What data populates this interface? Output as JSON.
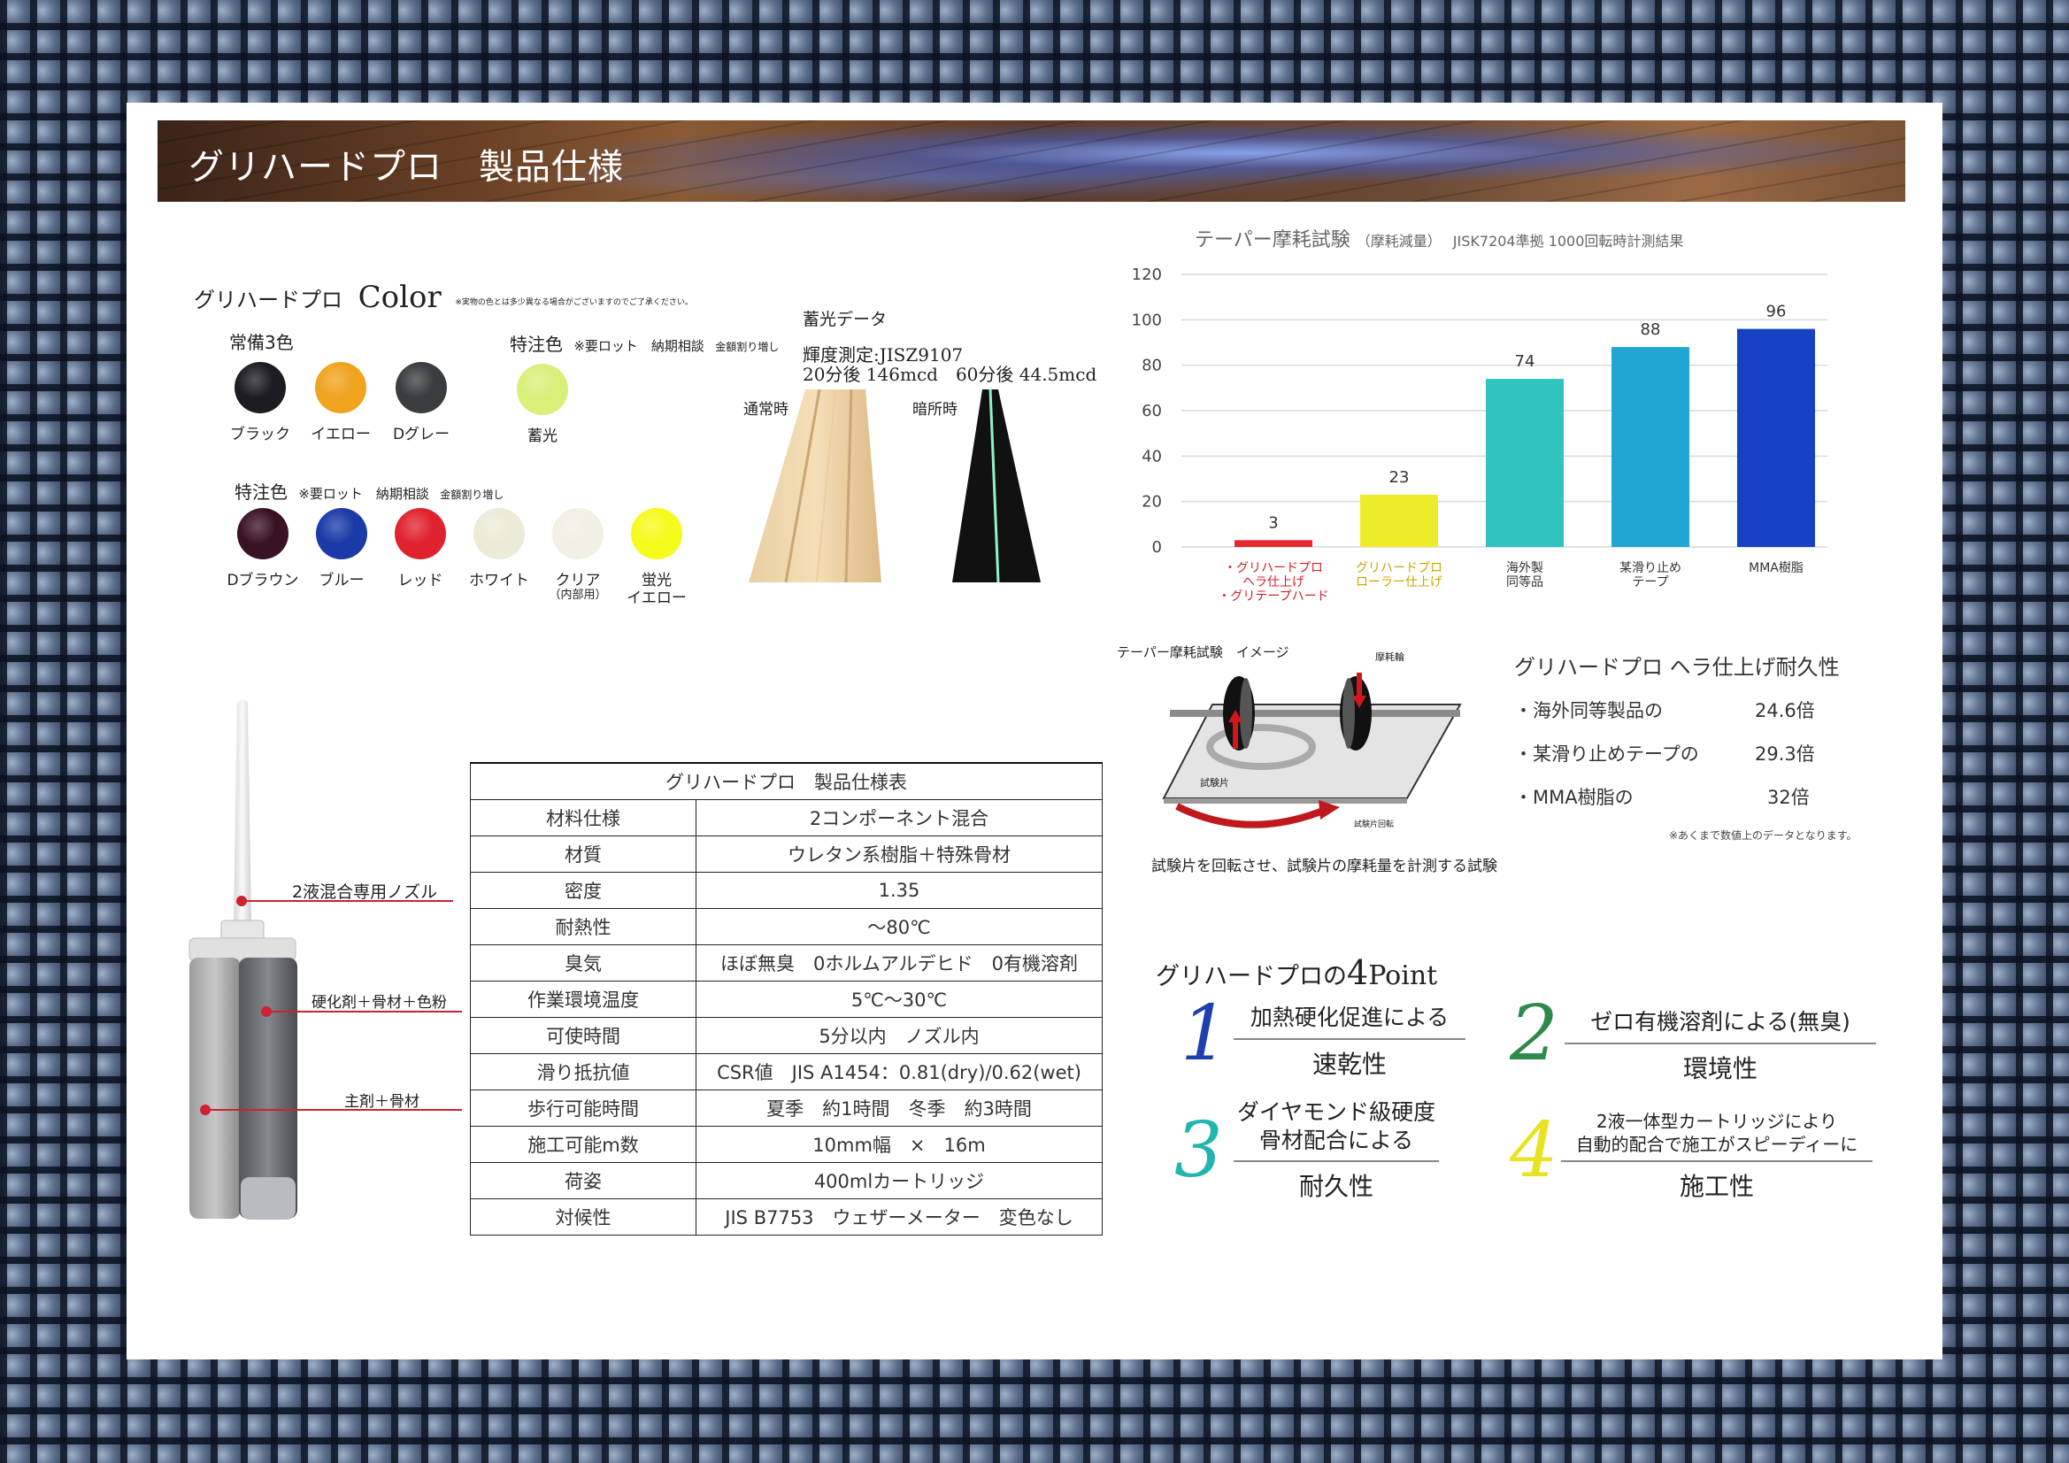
{
  "banner": {
    "title": "グリハードプロ　製品仕様"
  },
  "color": {
    "title": "グリハードプロ",
    "title_en": "Color",
    "note": "※実物の色とは多少異なる場合がございますのでご了承ください。",
    "standard_heading": "常備3色",
    "standard": [
      {
        "label": "ブラック",
        "color": "#1c1c22"
      },
      {
        "label": "イエロー",
        "color": "#f0a31e"
      },
      {
        "label": "Dグレー",
        "color": "#3a3d40"
      }
    ],
    "special1_heading": "特注色",
    "special1_note": "※要ロット　納期相談",
    "special1_note2": "金額割り増し",
    "special1": [
      {
        "label": "蓄光",
        "color": "#d8f07a"
      }
    ],
    "special2_heading": "特注色",
    "special2_note": "※要ロット　納期相談",
    "special2_note2": "金額割り増し",
    "special2": [
      {
        "label": "Dブラウン",
        "color": "#3a1226"
      },
      {
        "label": "ブルー",
        "color": "#1a3aa8"
      },
      {
        "label": "レッド",
        "color": "#e0222e"
      },
      {
        "label": "ホワイト",
        "color": "#ecebd8"
      },
      {
        "label": "クリア",
        "sub": "（内部用）",
        "color": "#f2efe4"
      },
      {
        "label": "蛍光",
        "sub": "イエロー",
        "color": "#f5fb1a"
      }
    ]
  },
  "phosphor": {
    "title": "蓄光データ",
    "line1": "輝度測定:JISZ9107",
    "line2": "20分後 146mcd　60分後 44.5mcd",
    "day_label": "通常時",
    "dark_label": "暗所時"
  },
  "chart_data": {
    "type": "bar",
    "title": "テーパー摩耗試験",
    "subtitle": "（摩耗減量）",
    "note": "JISK7204準拠 1000回転時計測結果",
    "ylim": [
      0,
      120
    ],
    "yticks": [
      0,
      20,
      40,
      60,
      80,
      100,
      120
    ],
    "grid": true,
    "categories": [
      "・グリハードプロ ヘラ仕上げ ・グリテープハード",
      "グリハードプロ ローラー仕上げ",
      "海外製 同等品",
      "某滑り止め テープ",
      "MMA樹脂"
    ],
    "category_lines": [
      [
        "・グリハードプロ",
        "ヘラ仕上げ",
        "・グリテープハード"
      ],
      [
        "グリハードプロ",
        "ローラー仕上げ"
      ],
      [
        "海外製",
        "同等品"
      ],
      [
        "某滑り止め",
        "テープ"
      ],
      [
        "MMA樹脂"
      ]
    ],
    "values": [
      3,
      23,
      74,
      88,
      96
    ],
    "bar_colors": [
      "#e8282e",
      "#ecec2a",
      "#2fc4bd",
      "#1fa6d2",
      "#1742c4"
    ],
    "label_colors": [
      "#d0222a",
      "#c8a600",
      "#333333",
      "#333333",
      "#333333"
    ]
  },
  "taber": {
    "title": "テーパー摩耗試験　イメージ",
    "wheel_label": "摩耗輪",
    "piece_label": "試験片",
    "rotate_label": "試験片回転",
    "caption": "試験片を回転させ、試験片の摩耗量を計測する試験"
  },
  "durability": {
    "title": "グリハードプロ ヘラ仕上げ耐久性",
    "rows": [
      {
        "label": "・海外同等製品の",
        "value": "24.6倍"
      },
      {
        "label": "・某滑り止めテープの",
        "value": "29.3倍"
      },
      {
        "label": "・MMA樹脂の",
        "value": "32倍"
      }
    ],
    "note": "※あくまで数値上のデータとなります。"
  },
  "cartridge": {
    "nozzle": "2液混合専用ノズル",
    "hardener": "硬化剤＋骨材＋色粉",
    "main": "主剤＋骨材"
  },
  "spec": {
    "title": "グリハードプロ　製品仕様表",
    "rows": [
      {
        "k": "材料仕様",
        "v": "2コンポーネント混合"
      },
      {
        "k": "材質",
        "v": "ウレタン系樹脂＋特殊骨材"
      },
      {
        "k": "密度",
        "v": "1.35"
      },
      {
        "k": "耐熱性",
        "v": "～80℃"
      },
      {
        "k": "臭気",
        "v": "ほぼ無臭　0ホルムアルデヒド　0有機溶剤"
      },
      {
        "k": "作業環境温度",
        "v": "5℃～30℃"
      },
      {
        "k": "可使時間",
        "v": "5分以内　ノズル内"
      },
      {
        "k": "滑り抵抗値",
        "v": "CSR値　JIS A1454：0.81(dry)/0.62(wet)"
      },
      {
        "k": "歩行可能時間",
        "v": "夏季　約1時間　冬季　約3時間"
      },
      {
        "k": "施工可能m数",
        "v": "10mm幅　×　16m"
      },
      {
        "k": "荷姿",
        "v": "400mlカートリッジ"
      },
      {
        "k": "対候性",
        "v": "JIS B7753　ウェザーメーター　変色なし"
      }
    ]
  },
  "points": {
    "title_a": "グリハードプロの",
    "title_num": "4",
    "title_b": "Point",
    "items": [
      {
        "num": "1",
        "color": "#1f3fb0",
        "top": "加熱硬化促進による",
        "bottom": "速乾性"
      },
      {
        "num": "2",
        "color": "#2e8a4a",
        "top": "ゼロ有機溶剤による(無臭)",
        "bottom": "環境性"
      },
      {
        "num": "3",
        "color": "#21b5b0",
        "top1": "ダイヤモンド級硬度",
        "top2": "骨材配合による",
        "bottom": "耐久性"
      },
      {
        "num": "4",
        "color": "#e9e21e",
        "top1": "2液一体型カートリッジにより",
        "top2": "自動的配合で施工がスピーディーに",
        "bottom": "施工性"
      }
    ]
  }
}
